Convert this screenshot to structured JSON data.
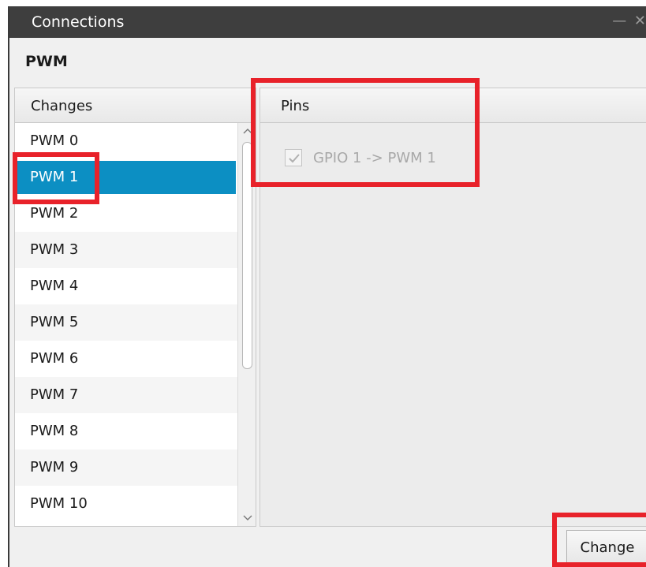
{
  "window": {
    "title": "Connections",
    "controls": "— ✕"
  },
  "section": {
    "title": "PWM"
  },
  "changes": {
    "header": "Changes",
    "selected_index": 1,
    "items": [
      "PWM 0",
      "PWM 1",
      "PWM 2",
      "PWM 3",
      "PWM 4",
      "PWM 5",
      "PWM 6",
      "PWM 7",
      "PWM 8",
      "PWM 9",
      "PWM 10"
    ]
  },
  "pins": {
    "header": "Pins",
    "items": [
      {
        "label": "GPIO 1 -> PWM 1",
        "checked": true,
        "enabled": false
      }
    ]
  },
  "actions": {
    "change_label": "Change"
  },
  "colors": {
    "selection": "#0c8fc3",
    "highlight": "#e8222a",
    "titlebar": "#3e3e3e"
  },
  "icons": {
    "checkmark": "check-icon",
    "scroll_up": "chevron-up-icon",
    "scroll_down": "chevron-down-icon"
  }
}
